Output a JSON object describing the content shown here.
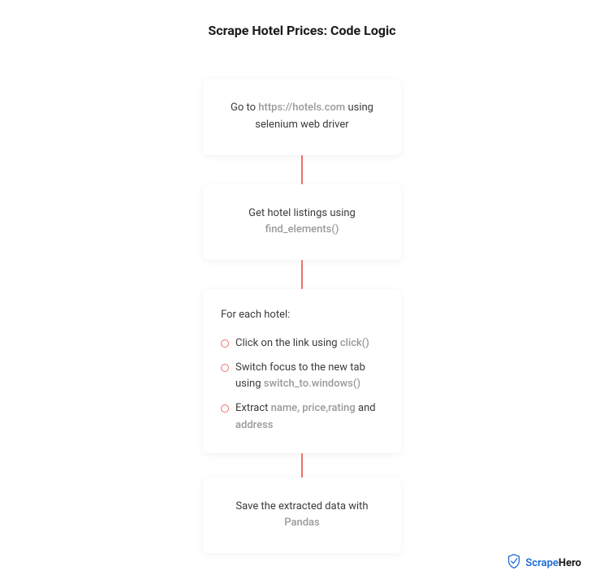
{
  "title": "Scrape Hotel Prices: Code Logic",
  "steps": {
    "step1": {
      "pre": "Go to ",
      "code": "https://hotels.com",
      "post": " using selenium web driver"
    },
    "step2": {
      "pre": "Get hotel listings using ",
      "code": "find_elements()"
    },
    "step3": {
      "heading": "For each hotel:",
      "items": [
        {
          "pre": "Click on the link using ",
          "code": "click()"
        },
        {
          "pre": "Switch focus to the new tab using ",
          "code": "switch_to.windows()"
        },
        {
          "pre": "Extract ",
          "code": "name, price,rating",
          "mid": " and ",
          "code2": "address"
        }
      ]
    },
    "step4": {
      "pre": "Save the extracted data with ",
      "code": "Pandas"
    }
  },
  "brand": {
    "blue": "Scrape",
    "black": "Hero"
  }
}
